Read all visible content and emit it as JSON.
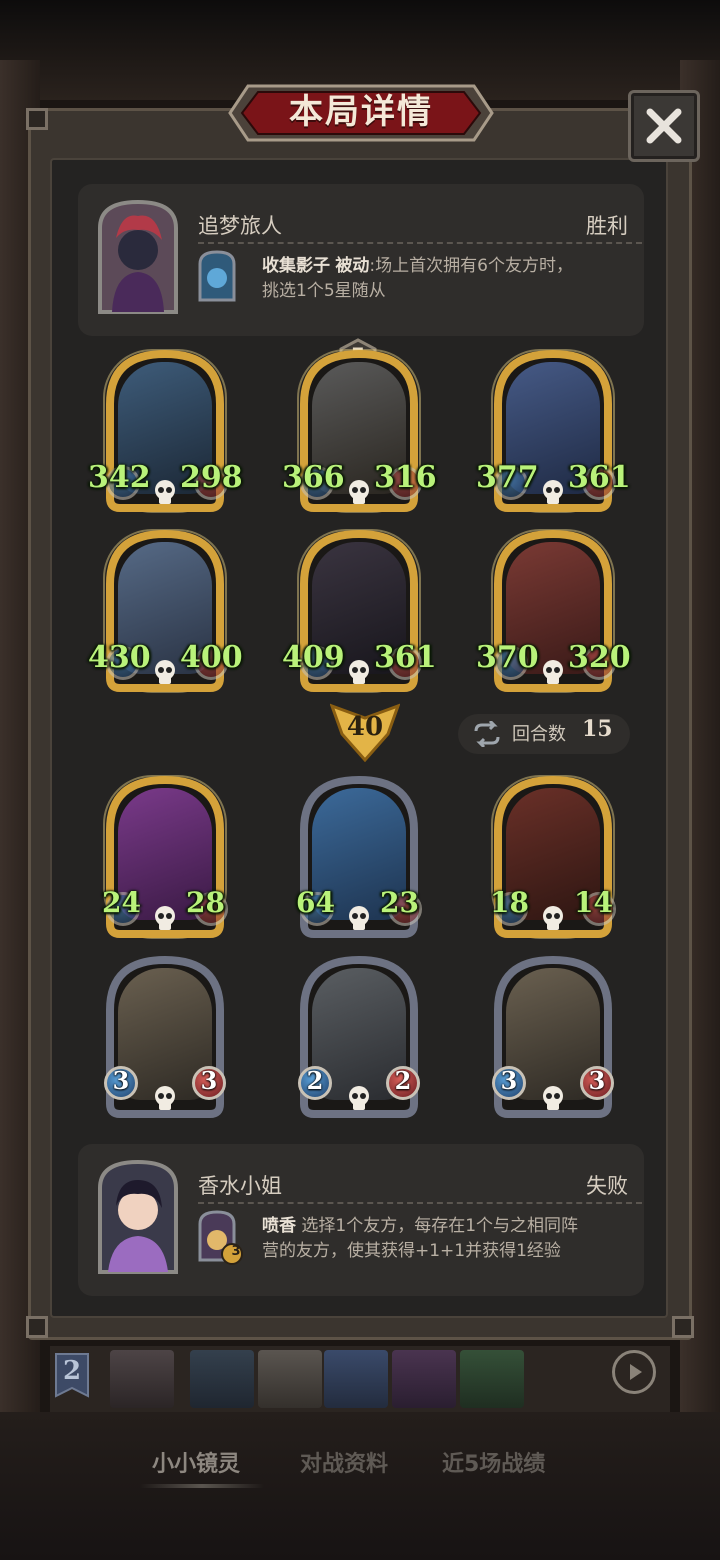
{
  "title": "本局详情",
  "close_icon": "close-x-icon",
  "winner": {
    "name": "追梦旅人",
    "result": "胜利",
    "skill_name": "收集影子",
    "skill_type": "被动",
    "skill_desc_line1": ":场上首次拥有6个友方时，",
    "skill_desc_line2": "挑选1个5星随从"
  },
  "tier_badge": "5",
  "winner_board": [
    {
      "attack": "342",
      "health": "298",
      "frame": "gold"
    },
    {
      "attack": "366",
      "health": "316",
      "frame": "gold"
    },
    {
      "attack": "377",
      "health": "361",
      "frame": "gold"
    },
    {
      "attack": "430",
      "health": "400",
      "frame": "gold"
    },
    {
      "attack": "409",
      "health": "361",
      "frame": "gold"
    },
    {
      "attack": "370",
      "health": "320",
      "frame": "gold"
    }
  ],
  "damage_level": "40",
  "rounds": {
    "label": "回合数",
    "value": "15"
  },
  "loser_board": [
    {
      "attack": "24",
      "health": "28",
      "frame": "gold"
    },
    {
      "attack": "64",
      "health": "23",
      "frame": "silver"
    },
    {
      "attack": "18",
      "health": "14",
      "frame": "gold"
    },
    {
      "attack": "3",
      "health": "3",
      "frame": "silver"
    },
    {
      "attack": "2",
      "health": "2",
      "frame": "silver"
    },
    {
      "attack": "3",
      "health": "3",
      "frame": "silver"
    }
  ],
  "loser": {
    "name": "香水小姐",
    "result": "失败",
    "skill_name": "喷香",
    "skill_badge": "3",
    "skill_desc_line1": "选择1个友方，每存在1个与之相同阵",
    "skill_desc_line2": "营的友方，使其获得+1+1并获得1经验"
  },
  "strip": {
    "rank": "2"
  },
  "tabs": [
    "小小镜灵",
    "对战资料",
    "近5场战绩"
  ],
  "colors": {
    "stat_green": "#b9f27a",
    "title_red": "#7a1418",
    "gold_frame": "#d4a23a",
    "silver_frame": "#6d7283"
  }
}
